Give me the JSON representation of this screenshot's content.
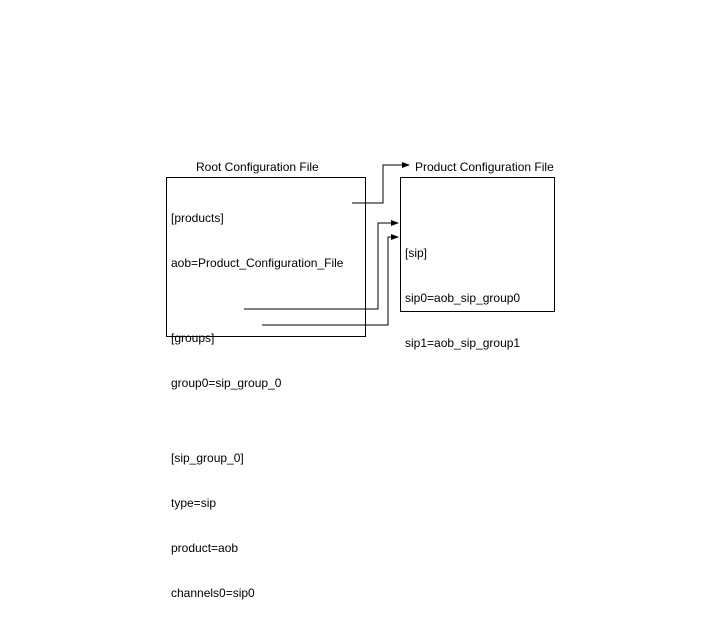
{
  "left": {
    "title": "Root Configuration File",
    "lines": {
      "l0": "[products]",
      "l1": "aob=Product_Configuration_File",
      "l2": "",
      "l3": "[groups]",
      "l4": "group0=sip_group_0",
      "l5": "",
      "l6": "[sip_group_0]",
      "l7": "type=sip",
      "l8": "product=aob",
      "l9": "channels0=sip0"
    }
  },
  "right": {
    "title": "Product Configuration File",
    "lines": {
      "l0": "[sip]",
      "l1": "sip0=aob_sip_group0",
      "l2": "sip1=aob_sip_group1"
    }
  }
}
